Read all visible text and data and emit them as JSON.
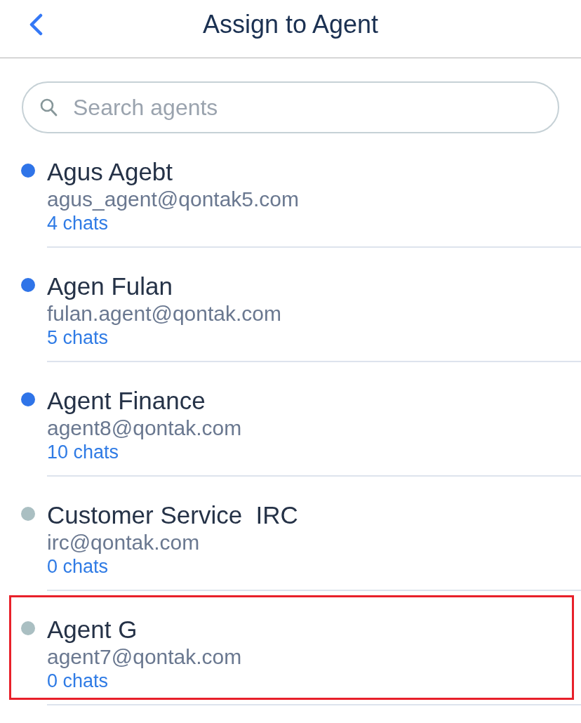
{
  "header": {
    "title": "Assign to Agent"
  },
  "search": {
    "placeholder": "Search agents"
  },
  "agents": [
    {
      "name": "Agus Agebt",
      "email": "agus_agent@qontak5.com",
      "chats": "4 chats",
      "color": "#2f74e8",
      "highlighted": false
    },
    {
      "name": "Agen Fulan",
      "email": "fulan.agent@qontak.com",
      "chats": "5 chats",
      "color": "#2f74e8",
      "highlighted": false
    },
    {
      "name": "Agent Finance",
      "email": "agent8@qontak.com",
      "chats": "10 chats",
      "color": "#2f74e8",
      "highlighted": false
    },
    {
      "name": "Customer Service  IRC",
      "email": "irc@qontak.com",
      "chats": "0 chats",
      "color": "#aabfc2",
      "highlighted": false
    },
    {
      "name": "Agent G",
      "email": "agent7@qontak.com",
      "chats": "0 chats",
      "color": "#aabfc2",
      "highlighted": true
    }
  ]
}
